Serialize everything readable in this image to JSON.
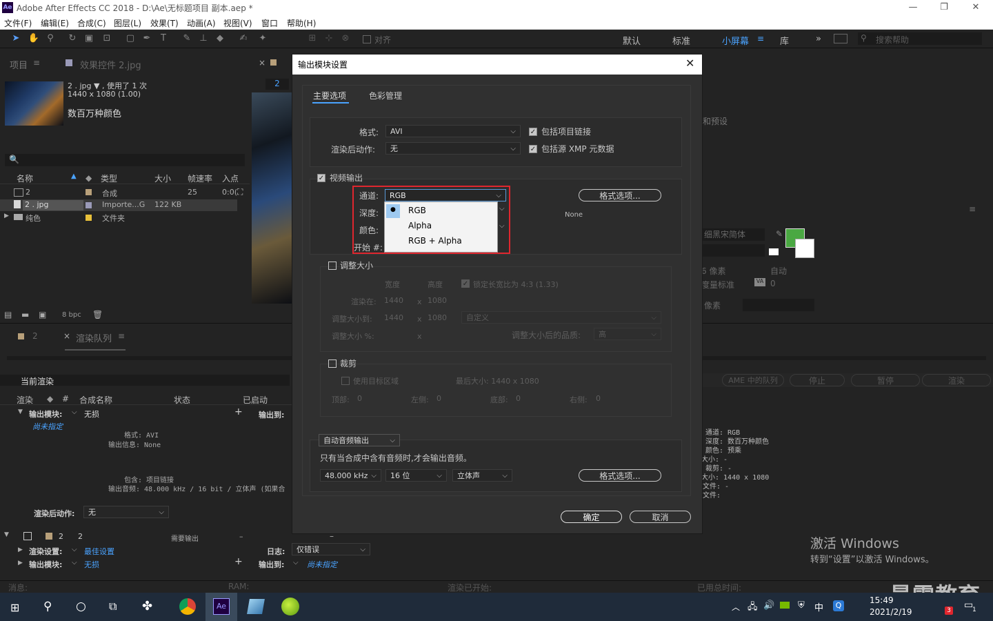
{
  "window": {
    "title": "Adobe After Effects CC 2018 - D:\\Ae\\无标题项目 副本.aep *",
    "logo": "Ae",
    "min": "—",
    "max": "❐",
    "close": "✕"
  },
  "menu": [
    "文件(F)",
    "编辑(E)",
    "合成(C)",
    "图层(L)",
    "效果(T)",
    "动画(A)",
    "视图(V)",
    "窗口",
    "帮助(H)"
  ],
  "toolbar": {
    "align_label": "对齐",
    "workspaces": [
      "默认",
      "标准",
      "小屏幕",
      "库"
    ],
    "search_placeholder": "搜索帮助",
    "more": "»"
  },
  "project": {
    "tab_project": "项目",
    "tab_effects": "效果控件 2.jpg",
    "item_name": "2 . jpg ▼ , 使用了 1 次",
    "item_size": "1440 x 1080 (1.00)",
    "item_color": "数百万种颜色",
    "search_icon": "🔍",
    "columns": [
      "名称",
      "类型",
      "大小",
      "帧速率",
      "入点"
    ],
    "rows": [
      {
        "name": "2",
        "type": "合成",
        "size": "",
        "fps": "25",
        "in": "0:0("
      },
      {
        "name": "2 . jpg",
        "type": "Importe...G",
        "size": "122 KB",
        "fps": "",
        "in": ""
      },
      {
        "name": "纯色",
        "type": "文件夹",
        "size": "",
        "fps": "",
        "in": ""
      }
    ],
    "bpc": "8 bpc"
  },
  "comp": {
    "tab_num": "2"
  },
  "right_panel": {
    "preset_label": "和预设",
    "font_name": "细黑宋简体",
    "pixel_label": "6 像素",
    "auto_label": "自动",
    "measure_label": "度量标准",
    "va_value": "0",
    "px_label": "像素",
    "fill_color": "#4aa842"
  },
  "render_queue": {
    "tab_num": "2",
    "tab_label": "渲染队列",
    "current_render": "当前渲染",
    "buttons": [
      "AME 中的队列",
      "停止",
      "暂停",
      "渲染"
    ],
    "columns": [
      "渲染",
      "#",
      "合成名称",
      "状态",
      "已启动"
    ],
    "output_module_label": "输出模块:",
    "output_module_value": "无损",
    "output_to_label": "输出到:",
    "not_specified": "尚未指定",
    "format_line": "格式: AVI",
    "output_info_line": "输出信息: None",
    "include_line": "包含: 项目链接",
    "output_audio_line": "输出音频: 48.000 kHz / 16 bit / 立体声 (如果合",
    "post_render_label": "渲染后动作:",
    "post_render_value": "无",
    "item_num": "2",
    "item_name": "2",
    "item_status": "需要输出",
    "item_dash": "–",
    "render_settings_label": "渲染设置:",
    "render_settings_value": "最佳设置",
    "log_label": "日志:",
    "log_value": "仅错误",
    "output_module2_value": "无损",
    "right_info": [
      "通道: RGB",
      "深度: 数百万种颜色",
      "颜色: 预乘",
      "大小: -",
      "裁剪: -",
      "大小: 1440 x 1080",
      "文件: -",
      "文件:"
    ],
    "status_bar": {
      "msg": "消息:",
      "ram": "RAM:",
      "render_started": "渲染已开始:",
      "total_time": "已用总时间:"
    }
  },
  "dialog": {
    "title": "输出模块设置",
    "close": "✕",
    "tabs": [
      "主要选项",
      "色彩管理"
    ],
    "format_label": "格式:",
    "format_value": "AVI",
    "post_label": "渲染后动作:",
    "post_value": "无",
    "include_link": "包括项目链接",
    "include_xmp": "包括源 XMP 元数据",
    "video_output": "视频输出",
    "channel_label": "通道:",
    "channel_value": "RGB",
    "depth_label": "深度:",
    "color_label": "颜色:",
    "start_label": "开始 #:",
    "channel_options": [
      "RGB",
      "Alpha",
      "RGB + Alpha"
    ],
    "format_options_btn": "格式选项...",
    "none_text": "None",
    "resize": "调整大小",
    "width_label": "宽度",
    "height_label": "高度",
    "lock_ratio": "锁定长宽比为 4:3 (1.33)",
    "render_at": "渲染在:",
    "render_w": "1440",
    "render_h": "1080",
    "x": "x",
    "resize_to": "调整大小到:",
    "resize_w": "1440",
    "resize_h": "1080",
    "custom": "自定义",
    "resize_pct": "调整大小 %:",
    "resize_quality": "调整大小后的品质:",
    "quality_value": "高",
    "crop": "裁剪",
    "use_roi": "使用目标区域",
    "final_size": "最后大小: 1440 x 1080",
    "top_label": "顶部:",
    "top_v": "0",
    "left_label": "左侧:",
    "left_v": "0",
    "bottom_label": "底部:",
    "bottom_v": "0",
    "right_label": "右侧:",
    "right_v": "0",
    "audio_mode": "自动音频输出",
    "audio_note": "只有当合成中含有音频时,才会输出音频。",
    "sample_rate": "48.000 kHz",
    "bit_depth": "16 位",
    "channels": "立体声",
    "audio_format_btn": "格式选项...",
    "ok": "确定",
    "cancel": "取消",
    "highlight_color": "#e0262e"
  },
  "watermark": {
    "line1": "激活 Windows",
    "line2": "转到“设置”以激活 Windows。",
    "brand": "最需教育"
  },
  "taskbar": {
    "time": "15:49",
    "date": "2021/2/19",
    "ime": "中",
    "badge": "3",
    "notif": "1"
  }
}
